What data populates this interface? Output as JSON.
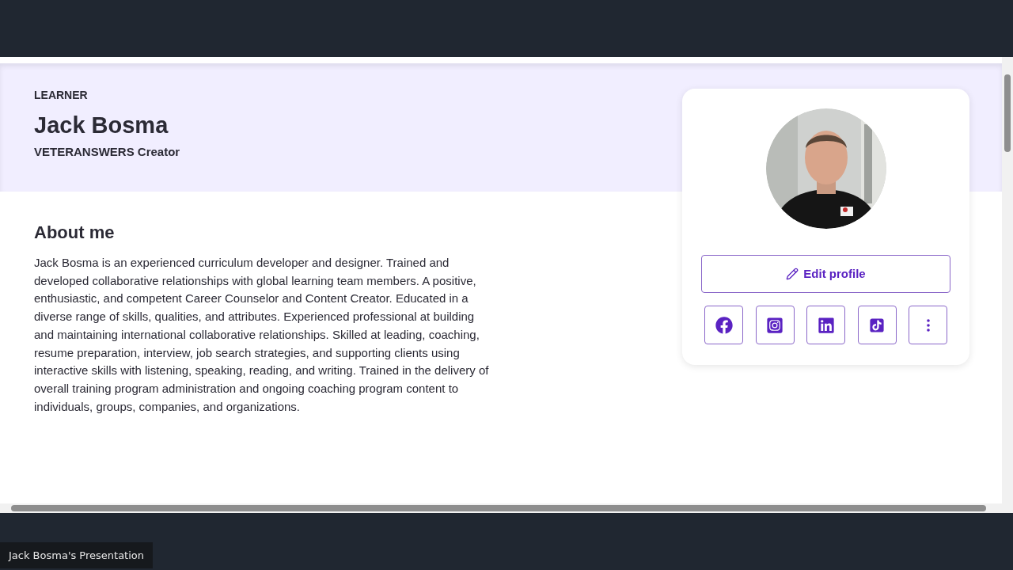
{
  "profile": {
    "role": "LEARNER",
    "name": "Jack Bosma",
    "headline": "VETERANSWERS Creator"
  },
  "about": {
    "title": "About me",
    "text": "Jack Bosma is an experienced curriculum developer and designer. Trained and developed collaborative relationships with global learning team members. A positive, enthusiastic, and competent Career Counselor and Content Creator. Educated in a diverse range of skills, qualities, and attributes. Experienced professional at building and maintaining international collaborative relationships. Skilled at leading, coaching, resume preparation, interview, job search strategies, and supporting clients using interactive skills with listening, speaking, reading, and writing. Trained in the delivery of overall training program administration and ongoing coaching program content to individuals, groups, companies, and organizations."
  },
  "card": {
    "edit_button": "Edit profile",
    "social_buttons": [
      {
        "kind": "facebook"
      },
      {
        "kind": "instagram"
      },
      {
        "kind": "linkedin"
      },
      {
        "kind": "tiktok"
      },
      {
        "kind": "more"
      }
    ]
  },
  "caption": "Jack Bosma's Presentation"
}
